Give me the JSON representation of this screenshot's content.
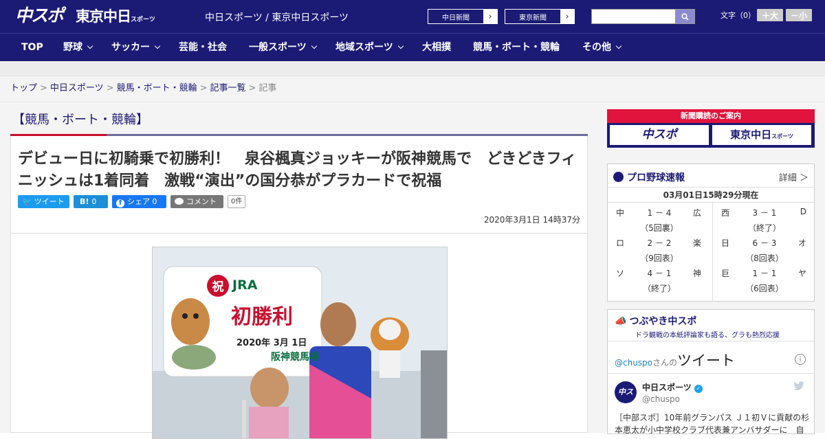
{
  "header": {
    "logo_main": "中スポ",
    "logo_sub": "東京中日",
    "logo_sub_small": "スポーツ",
    "site_links": "中日スポーツ / 東京中日スポーツ",
    "paper_buttons": [
      "中日新聞",
      "東京新聞"
    ],
    "search_placeholder": "",
    "font_size_label": "文字（0）",
    "font_bigger": "＋大",
    "font_smaller": "－小"
  },
  "nav": {
    "items": [
      {
        "label": "TOP",
        "dropdown": false
      },
      {
        "label": "野球",
        "dropdown": true
      },
      {
        "label": "サッカー",
        "dropdown": true
      },
      {
        "label": "芸能・社会",
        "dropdown": false
      },
      {
        "label": "一般スポーツ",
        "dropdown": true
      },
      {
        "label": "地域スポーツ",
        "dropdown": true
      },
      {
        "label": "大相撲",
        "dropdown": false
      },
      {
        "label": "競馬・ボート・競輪",
        "dropdown": false
      },
      {
        "label": "その他",
        "dropdown": true
      }
    ]
  },
  "breadcrumb": {
    "items": [
      "トップ",
      "中日スポーツ",
      "競馬・ボート・競輪",
      "記事一覧"
    ],
    "current": "記事"
  },
  "article": {
    "category": "【競馬・ボート・競輪】",
    "headline": "デビュー日に初騎乗で初勝利！　泉谷楓真ジョッキーが阪神競馬で　どきどきフィニッシュは1着同着　激戦“演出”の国分恭がプラカードで祝福",
    "share": {
      "tweet": "ツイート",
      "hatena": "B!",
      "hatena_count": "0",
      "facebook": "シェア",
      "facebook_count": "0",
      "comment": "コメント",
      "comment_count": "0件"
    },
    "date": "2020年3月1日 14時37分",
    "photo": {
      "sign_badge": "祝",
      "sign_org": "JRA",
      "sign_title": "初勝利",
      "sign_date": "2020年 3月 1日",
      "sign_venue": "阪神競馬場"
    }
  },
  "sidebar": {
    "subscribe": {
      "header": "新聞購読のご案内",
      "button_left": "中スポ",
      "button_right": "東京中日",
      "button_right_small": "スポーツ"
    },
    "baseball": {
      "title": "プロ野球速報",
      "detail": "詳細 ＞",
      "time": "03月01日15時29分現在",
      "games": [
        {
          "home": "中",
          "score": "1 － 4",
          "away": "広",
          "status": "（5回裏）"
        },
        {
          "home": "ロ",
          "score": "2 － 2",
          "away": "楽",
          "status": "（9回表）"
        },
        {
          "home": "ソ",
          "score": "4 － 1",
          "away": "神",
          "status": "（終了）"
        },
        {
          "home": "西",
          "score": "3 － 1",
          "away": "D",
          "status": "（終了）"
        },
        {
          "home": "日",
          "score": "6 － 3",
          "away": "オ",
          "status": "（8回表）"
        },
        {
          "home": "巨",
          "score": "1 － 1",
          "away": "ヤ",
          "status": "（6回表）"
        }
      ]
    },
    "twitter": {
      "title": "つぶやき中スポ",
      "subtitle": "ドラ観戦の本紙評論家も語る、グラも熱烈応援",
      "handle_link": "@chuspo",
      "san": "さんの",
      "tweet_word": "ツイート",
      "info": "i",
      "avatar": "中スポ",
      "name": "中日スポーツ",
      "handle": "@chuspo",
      "text": "［中部スポ］10年前グランパス Ｊ１初Ｖに貢献の杉本恵太が小中学校クラブ代表兼アンバサダーに　自"
    }
  }
}
